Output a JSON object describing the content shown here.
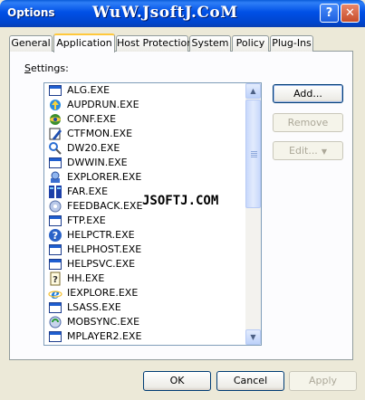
{
  "window": {
    "title": "Options",
    "watermark": "WuW.JsoftJ.CoM",
    "help_glyph": "?",
    "close_glyph": "✕"
  },
  "tabs": [
    {
      "label": "General"
    },
    {
      "label": "Application",
      "active": true
    },
    {
      "label": "Host Protection"
    },
    {
      "label": "System"
    },
    {
      "label": "Policy"
    },
    {
      "label": "Plug-Ins"
    }
  ],
  "settings": {
    "label_prefix": "S",
    "label_rest": "ettings:",
    "items": [
      {
        "name": "ALG.EXE",
        "icon": "window-icon"
      },
      {
        "name": "AUPDRUN.EXE",
        "icon": "update-icon"
      },
      {
        "name": "CONF.EXE",
        "icon": "conference-icon"
      },
      {
        "name": "CTFMON.EXE",
        "icon": "pen-icon"
      },
      {
        "name": "DW20.EXE",
        "icon": "dr-watson-icon"
      },
      {
        "name": "DWWIN.EXE",
        "icon": "window-icon"
      },
      {
        "name": "EXPLORER.EXE",
        "icon": "explorer-icon"
      },
      {
        "name": "FAR.EXE",
        "icon": "far-manager-icon"
      },
      {
        "name": "FEEDBACK.EXE",
        "icon": "feedback-icon"
      },
      {
        "name": "FTP.EXE",
        "icon": "window-icon"
      },
      {
        "name": "HELPCTR.EXE",
        "icon": "help-icon"
      },
      {
        "name": "HELPHOST.EXE",
        "icon": "window-icon"
      },
      {
        "name": "HELPSVC.EXE",
        "icon": "window-icon"
      },
      {
        "name": "HH.EXE",
        "icon": "help-file-icon"
      },
      {
        "name": "IEXPLORE.EXE",
        "icon": "internet-explorer-icon"
      },
      {
        "name": "LSASS.EXE",
        "icon": "window-icon"
      },
      {
        "name": "MOBSYNC.EXE",
        "icon": "sync-icon"
      },
      {
        "name": "MPLAYER2.EXE",
        "icon": "window-icon"
      }
    ],
    "overlay_text": "JSOFTJ.COM"
  },
  "side_buttons": {
    "add": "Add...",
    "remove": "Remove",
    "edit": "Edit...",
    "edit_arrow": "▼"
  },
  "footer": {
    "ok": "OK",
    "cancel": "Cancel",
    "apply": "Apply"
  },
  "scroll": {
    "up": "▲",
    "down": "▼"
  }
}
